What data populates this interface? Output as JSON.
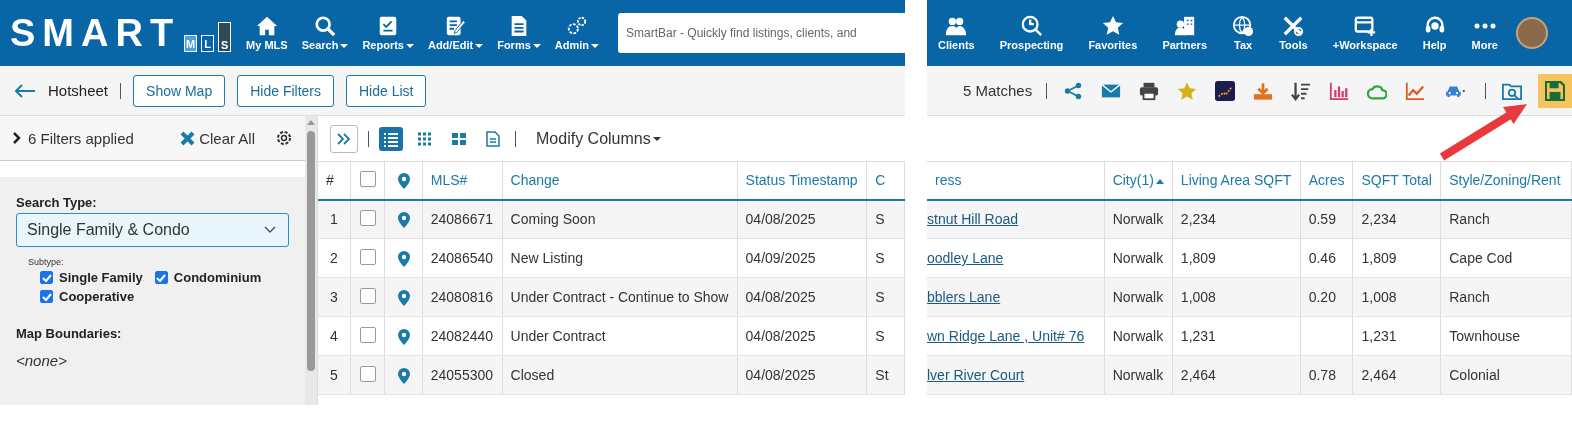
{
  "left": {
    "header": {
      "logo": {
        "word": "SMART",
        "letters": [
          {
            "text": "M",
            "kind": "light"
          },
          {
            "text": "L",
            "kind": "outline"
          },
          {
            "text": "S",
            "kind": "dark"
          }
        ]
      },
      "nav": [
        {
          "label": "My MLS",
          "kind": "home",
          "caret": false
        },
        {
          "label": "Search",
          "kind": "search",
          "caret": true
        },
        {
          "label": "Reports",
          "kind": "report",
          "caret": true
        },
        {
          "label": "Add/Edit",
          "kind": "edit",
          "caret": true
        },
        {
          "label": "Forms",
          "kind": "form",
          "caret": true
        },
        {
          "label": "Admin",
          "kind": "gears",
          "caret": true
        }
      ],
      "search": {
        "placeholder": "SmartBar - Quickly find listings, clients, and"
      }
    },
    "toolbar": {
      "title": "Hotsheet",
      "buttons": [
        "Show Map",
        "Hide Filters",
        "Hide List"
      ]
    },
    "filters": {
      "summary": "6 Filters applied",
      "clear": "Clear All",
      "search_type_label": "Search Type:",
      "search_type": "Single Family & Condo",
      "subtype_label": "Subtype:",
      "subtypes": [
        {
          "label": "Single Family",
          "checked": true
        },
        {
          "label": "Condominium",
          "checked": true
        },
        {
          "label": "Cooperative",
          "checked": true
        }
      ],
      "map_label": "Map Boundaries:",
      "map_value": "<none>"
    },
    "table_toolbar": {
      "views": [
        {
          "kind": "list",
          "selected": true
        },
        {
          "kind": "grid",
          "selected": false
        },
        {
          "kind": "tiles",
          "selected": false
        },
        {
          "kind": "doc",
          "selected": false
        }
      ],
      "modify": "Modify Columns"
    },
    "table": {
      "columns": [
        {
          "label": "#",
          "kind": "plain"
        },
        {
          "kind": "checkbox",
          "checked": false
        },
        {
          "kind": "pin"
        },
        {
          "label": "MLS#",
          "kind": "link"
        },
        {
          "label": "Change",
          "kind": "link"
        },
        {
          "label": "Status Timestamp",
          "kind": "link"
        },
        {
          "label": "C",
          "kind": "link"
        }
      ],
      "rows": [
        {
          "num": "1",
          "checked": false,
          "mls": "24086671",
          "change": "Coming Soon",
          "timestamp": "04/08/2025",
          "column_7": "S"
        },
        {
          "num": "2",
          "checked": false,
          "mls": "24086540",
          "change": "New Listing",
          "timestamp": "04/09/2025",
          "column_7": "S"
        },
        {
          "num": "3",
          "checked": false,
          "mls": "24080816",
          "change": "Under Contract - Continue to Show",
          "timestamp": "04/08/2025",
          "column_7": "S"
        },
        {
          "num": "4",
          "checked": false,
          "mls": "24082440",
          "change": "Under Contract",
          "timestamp": "04/08/2025",
          "column_7": "S"
        },
        {
          "num": "5",
          "checked": false,
          "mls": "24055300",
          "change": "Closed",
          "timestamp": "04/08/2025",
          "column_7": "St"
        }
      ]
    }
  },
  "right": {
    "header": {
      "nav": [
        {
          "label": "Clients",
          "kind": "people"
        },
        {
          "label": "Prospecting",
          "kind": "clock"
        },
        {
          "label": "Favorites",
          "kind": "star"
        },
        {
          "label": "Partners",
          "kind": "partners"
        },
        {
          "label": "Tax",
          "kind": "globe"
        },
        {
          "label": "Tools",
          "kind": "tools"
        },
        {
          "label": "+Workspace",
          "kind": "workspace"
        },
        {
          "label": "Help",
          "kind": "headset"
        },
        {
          "label": "More",
          "kind": "dots"
        }
      ]
    },
    "toolbar": {
      "matches": "5 Matches",
      "tools": [
        {
          "kind": "share",
          "highlighted": false
        },
        {
          "kind": "mail",
          "highlighted": false
        },
        {
          "kind": "print",
          "highlighted": false
        },
        {
          "kind": "star",
          "highlighted": false
        },
        {
          "kind": "trend",
          "highlighted": false
        },
        {
          "kind": "download",
          "highlighted": false
        },
        {
          "kind": "sort",
          "highlighted": false
        },
        {
          "kind": "bars",
          "highlighted": false
        },
        {
          "kind": "cloud",
          "highlighted": false
        },
        {
          "kind": "line",
          "highlighted": false
        },
        {
          "kind": "car",
          "highlighted": false
        },
        {
          "kind": "divider"
        },
        {
          "kind": "folder",
          "highlighted": false
        },
        {
          "kind": "save",
          "highlighted": true
        }
      ]
    },
    "table": {
      "columns": [
        {
          "label": "ress"
        },
        {
          "label": "City(1)",
          "sorted": true
        },
        {
          "label": "Living Area SQFT"
        },
        {
          "label": "Acres"
        },
        {
          "label": "SQFT Total"
        },
        {
          "label": "Style/Zoning/Rent"
        }
      ],
      "rows": [
        {
          "address": "stnut Hill Road",
          "city": "Norwalk",
          "living_area": "2,234",
          "acres": "0.59",
          "sqft_total": "2,234",
          "style": "Ranch"
        },
        {
          "address": "oodley Lane",
          "city": "Norwalk",
          "living_area": "1,809",
          "acres": "0.46",
          "sqft_total": "1,809",
          "style": "Cape Cod"
        },
        {
          "address": "bblers Lane",
          "city": "Norwalk",
          "living_area": "1,008",
          "acres": "0.20",
          "sqft_total": "1,008",
          "style": "Ranch"
        },
        {
          "address": "wn Ridge Lane , Unit# 76",
          "city": "Norwalk",
          "living_area": "1,231",
          "sqft_total": "1,231",
          "style": "Townhouse"
        },
        {
          "address": "lver River Court",
          "city": "Norwalk",
          "living_area": "2,464",
          "acres": "0.78",
          "sqft_total": "2,464",
          "style": "Colonial"
        }
      ]
    }
  }
}
